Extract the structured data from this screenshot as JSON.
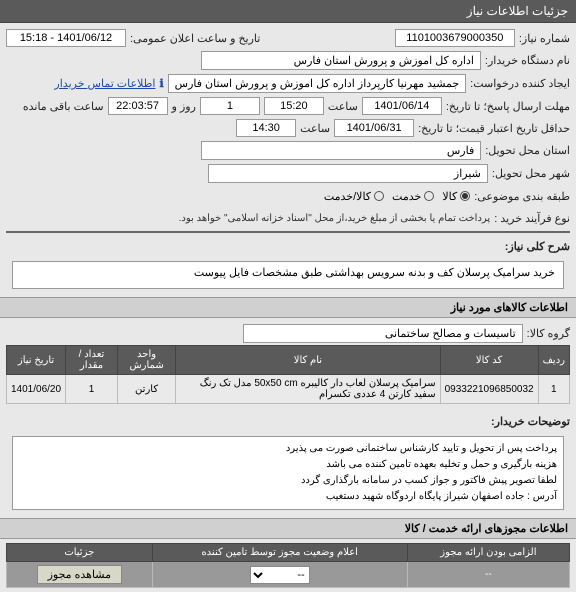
{
  "header": {
    "title": "جزئیات اطلاعات نیاز"
  },
  "fields": {
    "need_no_label": "شماره نیاز:",
    "need_no": "1101003679000350",
    "announce_label": "تاریخ و ساعت اعلان عمومی:",
    "announce_val": "1401/06/12 - 15:18",
    "buyer_label": "نام دستگاه خریدار:",
    "buyer_val": "اداره کل اموزش و پرورش استان فارس",
    "creator_label": "ایجاد کننده درخواست:",
    "creator_val": "جمشید مهرنیا کارپرداز اداره کل اموزش و پرورش استان فارس",
    "contact_link": "اطلاعات تماس خریدار",
    "info_icon": "ℹ",
    "deadline_send_label": "مهلت ارسال پاسخ؛ تا تاریخ:",
    "date1": "1401/06/14",
    "time_label": "ساعت",
    "time1": "15:20",
    "day_label": "روز و",
    "days_left": "1",
    "remain_time": "22:03:57",
    "remain_label": "ساعت باقی مانده",
    "validity_label": "حداقل تاریخ اعتبار قیمت؛ تا تاریخ:",
    "date2": "1401/06/31",
    "time2": "14:30",
    "province_label": "استان محل تحویل:",
    "province_val": "فارس",
    "city_label": "شهر محل تحویل:",
    "city_val": "شیراز",
    "category_label": "طبقه بندی موضوعی:",
    "cat_goods": "کالا",
    "cat_service": "خدمت",
    "cat_goods_service": "کالا/خدمت",
    "process_label": "نوع فرآیند خرید :",
    "process_note": "پرداخت تمام یا بخشی از مبلغ خرید،از محل \"اسناد خزانه اسلامی\" خواهد بود.",
    "desc_label": "شرح کلی نیاز:",
    "desc_val": "خرید سرامیک پرسلان کف و بدنه سرویس بهداشتی طبق مشخصات فایل پیوست",
    "items_header": "اطلاعات کالاهای مورد نیاز",
    "group_label": "گروه کالا:",
    "group_val": "تاسیسات و مصالح ساختمانی",
    "table": {
      "h_row": "ردیف",
      "h_code": "کد کالا",
      "h_name": "نام کالا",
      "h_unit": "واحد شمارش",
      "h_qty": "تعداد / مقدار",
      "h_date": "تاریخ نیاز",
      "r_row": "1",
      "r_code": "0933221096850032",
      "r_name": "سرامیک پرسلان لعاب دار کالیبره 50x50 cm مدل تک رنگ سفید کارتن 4 عددی تکسرام",
      "r_unit": "کارتن",
      "r_qty": "1",
      "r_date": "1401/06/20"
    },
    "buyer_notes_label": "توضیحات خریدار:",
    "buyer_notes": "پرداخت پس از تحویل و تایید کارشناس ساختمانی صورت می پذیرد\nهزینه بارگیری و حمل و تخلیه بعهده تامین کننده می باشد\nلطفا تصویر پیش فاکتور و جواز کسب در سامانه بارگذاری گردد\nآدرس :  جاده اصفهان شیراز پایگاه  اردوگاه شهید دستغیب",
    "auth_header": "اطلاعات مجوزهای ارائه خدمت / کالا",
    "auth_table": {
      "h_required": "الزامی بودن ارائه مجوز",
      "h_status": "اعلام وضعیت مجوز توسط تامین کننده",
      "h_details": "جزئیات",
      "dash": "--",
      "view_btn": "مشاهده مجوز"
    }
  }
}
